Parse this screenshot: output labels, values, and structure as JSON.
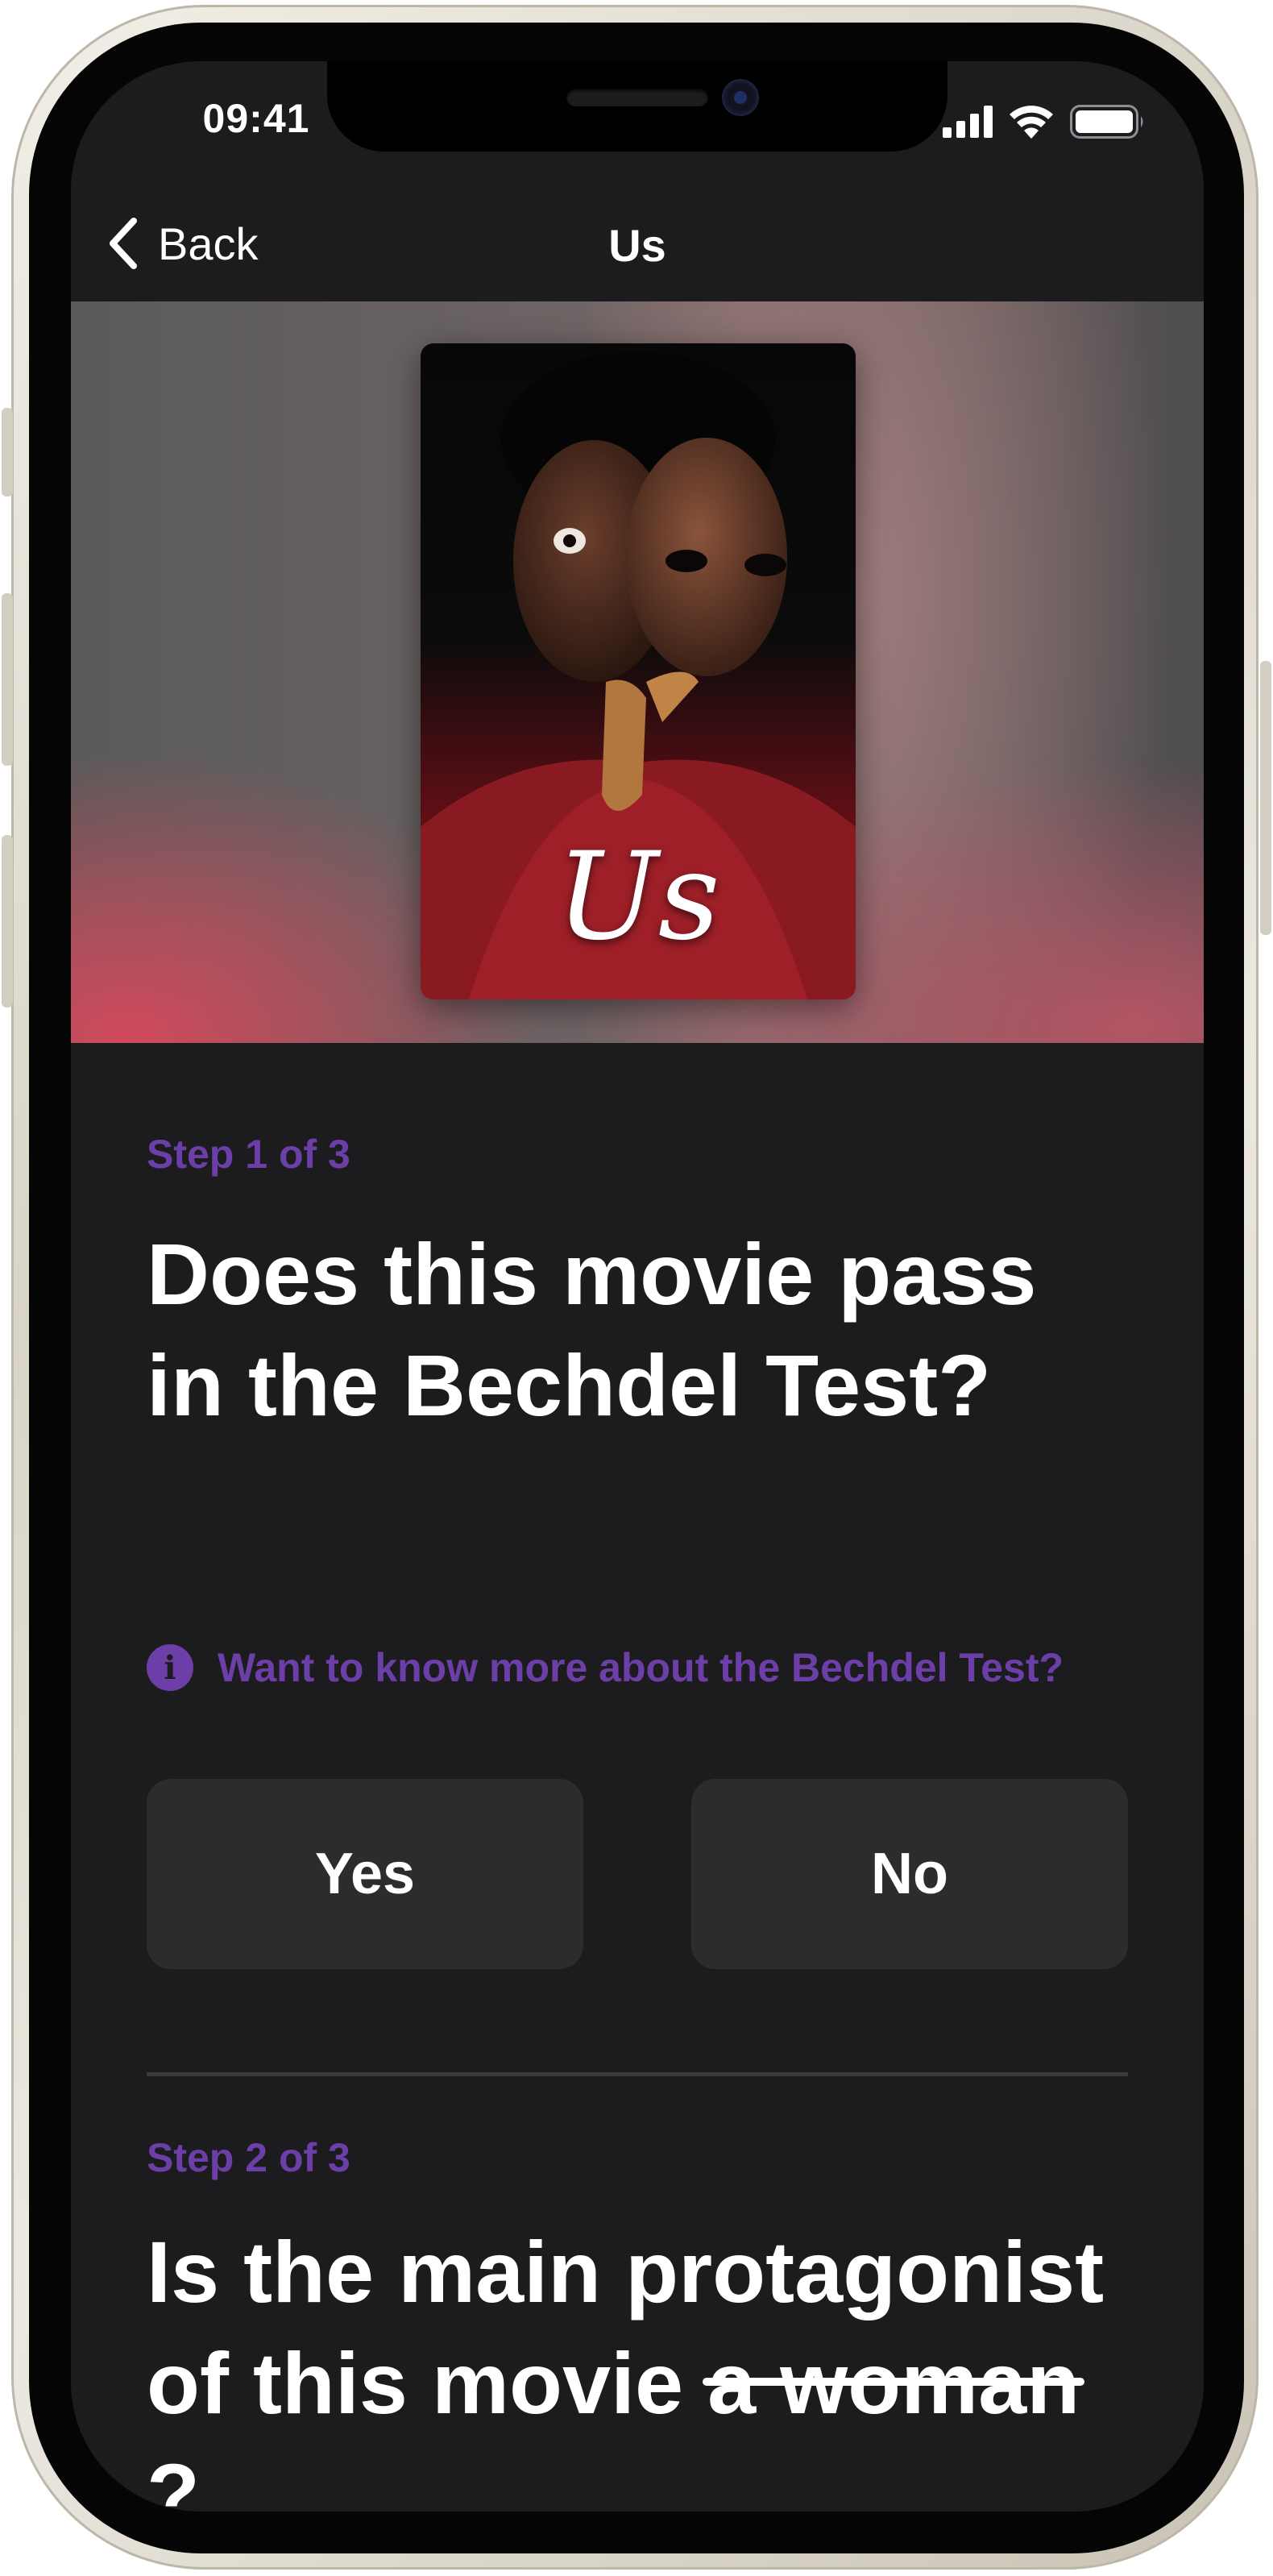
{
  "status_bar": {
    "time": "09:41"
  },
  "nav": {
    "back_label": "Back",
    "title": "Us"
  },
  "poster": {
    "title": "Us"
  },
  "step1": {
    "label": "Step 1 of 3",
    "question": "Does this movie pass in the Bechdel Test?",
    "info_icon": "i",
    "info_link": "Want to know more about the Bechdel Test?",
    "yes_label": "Yes",
    "no_label": "No"
  },
  "step2": {
    "label": "Step 2 of 3",
    "question_main": "Is the main protagonist of this movie ",
    "question_struck": "a woman",
    "question_end": "?"
  },
  "icons": [
    "chevron-left-icon",
    "cellular-signal-icon",
    "wifi-icon",
    "battery-icon",
    "info-icon"
  ],
  "colors": {
    "accent": "#6c3fa8",
    "background": "#1c1c1e",
    "button": "#2c2c2e"
  }
}
